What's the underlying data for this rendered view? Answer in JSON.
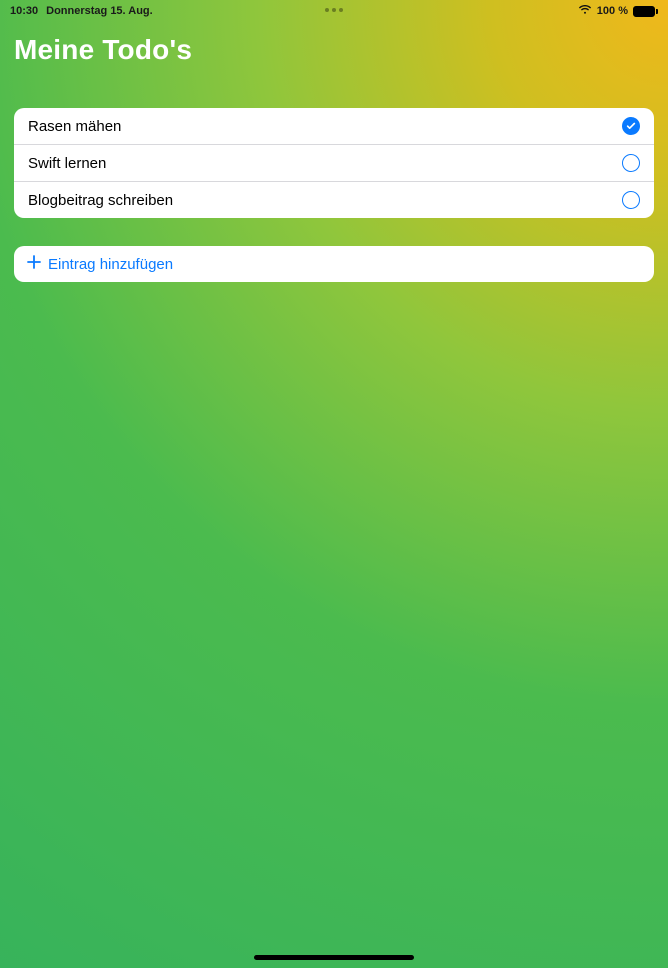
{
  "status_bar": {
    "time": "10:30",
    "date": "Donnerstag 15. Aug.",
    "battery_text": "100 %"
  },
  "title": "Meine Todo's",
  "todos": [
    {
      "label": "Rasen mähen",
      "done": true
    },
    {
      "label": "Swift lernen",
      "done": false
    },
    {
      "label": "Blogbeitrag schreiben",
      "done": false
    }
  ],
  "add_entry_label": "Eintrag hinzufügen",
  "colors": {
    "accent": "#0a7aff"
  }
}
